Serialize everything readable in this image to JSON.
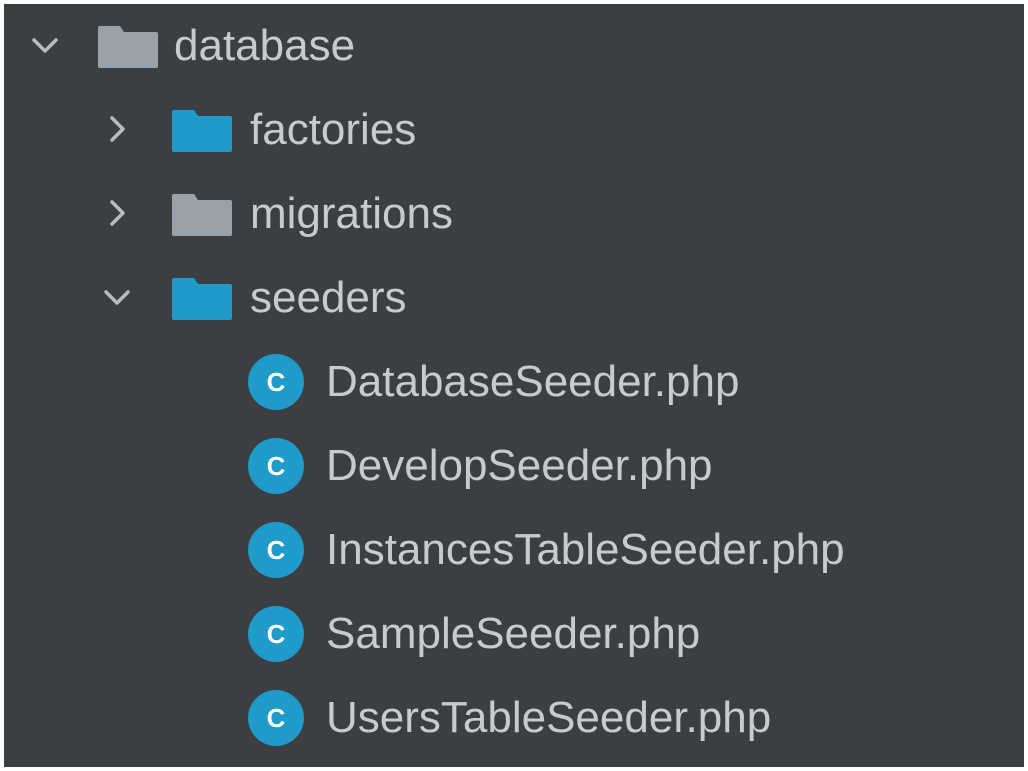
{
  "colors": {
    "panel_background": "#3c3f41",
    "text": "#c8cacc",
    "chevron": "#b9bbbe",
    "folder_plain": "#9aa2a9",
    "folder_source": "#1f9ac9",
    "class_icon": "#1f9ac9",
    "class_letter": "#ffffff"
  },
  "tree": {
    "root": {
      "label": "database",
      "expanded": true,
      "icon": "folder-icon"
    },
    "children": [
      {
        "label": "factories",
        "expanded": false,
        "icon": "source-folder-icon"
      },
      {
        "label": "migrations",
        "expanded": false,
        "icon": "folder-icon"
      },
      {
        "label": "seeders",
        "expanded": true,
        "icon": "source-folder-icon",
        "files": [
          {
            "label": "DatabaseSeeder.php",
            "icon": "php-class-icon",
            "icon_letter": "C"
          },
          {
            "label": "DevelopSeeder.php",
            "icon": "php-class-icon",
            "icon_letter": "C"
          },
          {
            "label": "InstancesTableSeeder.php",
            "icon": "php-class-icon",
            "icon_letter": "C"
          },
          {
            "label": "SampleSeeder.php",
            "icon": "php-class-icon",
            "icon_letter": "C"
          },
          {
            "label": "UsersTableSeeder.php",
            "icon": "php-class-icon",
            "icon_letter": "C"
          }
        ]
      }
    ]
  }
}
